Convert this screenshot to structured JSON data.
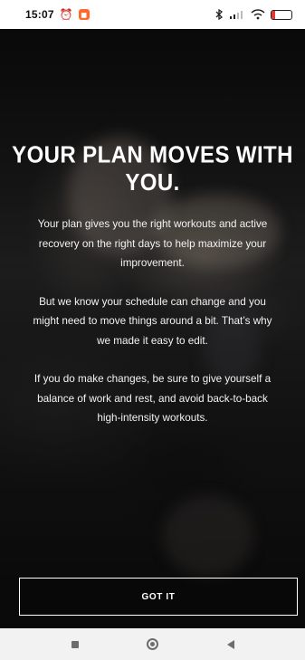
{
  "status_bar": {
    "time": "15:07",
    "alarm_icon": "alarm-off-icon",
    "notification_icon": "app-notification-icon",
    "bluetooth_icon": "bluetooth-icon",
    "signal_icon": "cellular-signal-icon",
    "wifi_icon": "wifi-icon",
    "battery_level": "17"
  },
  "content": {
    "headline": "YOUR PLAN MOVES WITH YOU.",
    "paragraphs": [
      "Your plan gives you the right workouts and active recovery on the right days to help maximize your improvement.",
      "But we know your schedule can change and you might need to move things around a bit. That’s why we made it easy to edit.",
      "If you do make changes, be sure to give yourself a balance of work and rest, and avoid back-to-back high-intensity workouts."
    ],
    "primary_button": "GOT IT"
  },
  "navigation": {
    "recent_apps_icon": "square-icon",
    "home_icon": "circle-home-icon",
    "back_icon": "back-triangle-icon"
  },
  "colors": {
    "text": "#ffffff",
    "status_bar_background": "#ffffff",
    "navigation_bar_background": "#f2f2f2",
    "notification_accent": "#ff6a2b",
    "battery_low": "#e53935"
  }
}
